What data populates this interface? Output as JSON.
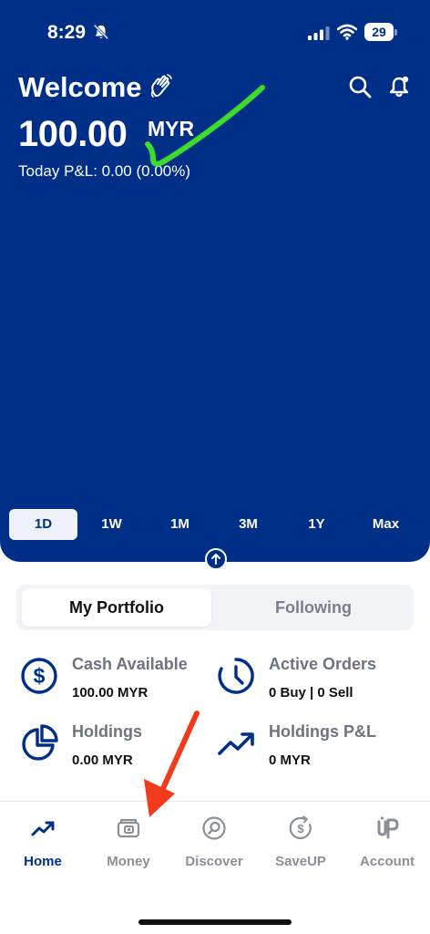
{
  "status_bar": {
    "time": "8:29",
    "battery": "29"
  },
  "header": {
    "greeting": "Welcome",
    "balance": "100.00",
    "currency": "MYR",
    "today_pnl": "Today P&L: 0.00 (0.00%)"
  },
  "time_ranges": [
    {
      "label": "1D",
      "active": true
    },
    {
      "label": "1W",
      "active": false
    },
    {
      "label": "1M",
      "active": false
    },
    {
      "label": "3M",
      "active": false
    },
    {
      "label": "1Y",
      "active": false
    },
    {
      "label": "Max",
      "active": false
    }
  ],
  "tabs": {
    "portfolio": "My Portfolio",
    "following": "Following",
    "selected": "My Portfolio"
  },
  "stats": {
    "cash": {
      "label": "Cash Available",
      "value": "100.00 MYR"
    },
    "orders": {
      "label": "Active Orders",
      "value": "0 Buy | 0 Sell"
    },
    "holdings": {
      "label": "Holdings",
      "value": "0.00 MYR"
    },
    "holdings_pnl": {
      "label": "Holdings P&L",
      "value": "0 MYR"
    }
  },
  "bottom_nav": [
    {
      "label": "Home",
      "icon": "trending-up-icon",
      "active": true
    },
    {
      "label": "Money",
      "icon": "wallet-icon",
      "active": false
    },
    {
      "label": "Discover",
      "icon": "discover-search-icon",
      "active": false
    },
    {
      "label": "SaveUP",
      "icon": "saveup-icon",
      "active": false
    },
    {
      "label": "Account",
      "icon": "account-logo-icon",
      "active": false
    }
  ],
  "colors": {
    "brand": "#002F87",
    "annotation_green": "#3DDC2A",
    "annotation_red": "#F23A1D",
    "inactive_gray": "#8B8F98"
  }
}
